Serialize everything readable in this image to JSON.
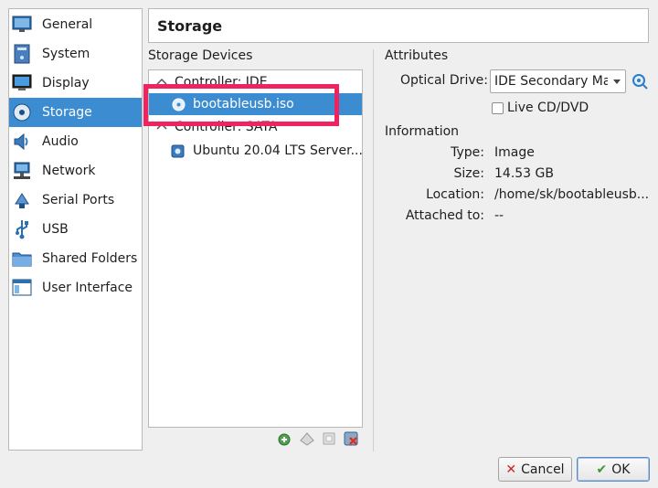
{
  "sidebar": {
    "items": [
      {
        "label": "General"
      },
      {
        "label": "System"
      },
      {
        "label": "Display"
      },
      {
        "label": "Storage"
      },
      {
        "label": "Audio"
      },
      {
        "label": "Network"
      },
      {
        "label": "Serial Ports"
      },
      {
        "label": "USB"
      },
      {
        "label": "Shared Folders"
      },
      {
        "label": "User Interface"
      }
    ],
    "selected": "Storage"
  },
  "header": {
    "title": "Storage"
  },
  "storage_devices": {
    "label": "Storage Devices",
    "tree": [
      {
        "label": "Controller: IDE"
      },
      {
        "label": "bootableusb.iso"
      },
      {
        "label": "Controller: SATA"
      },
      {
        "label": "Ubuntu 20.04 LTS Server...."
      }
    ],
    "selected": "bootableusb.iso"
  },
  "attributes": {
    "label": "Attributes",
    "optical_drive_label": "Optical Drive:",
    "optical_drive_value": "IDE Secondary Master",
    "live_cd_label": "Live CD/DVD",
    "live_cd_checked": false
  },
  "information": {
    "label": "Information",
    "rows": [
      {
        "key": "Type:",
        "value": "Image"
      },
      {
        "key": "Size:",
        "value": "14.53 GB"
      },
      {
        "key": "Location:",
        "value": "/home/sk/bootableusb..."
      },
      {
        "key": "Attached to:",
        "value": "--"
      }
    ]
  },
  "buttons": {
    "cancel": "Cancel",
    "ok": "OK"
  },
  "colors": {
    "selection": "#3b8cd0",
    "highlight_annotation": "#f0225f"
  }
}
